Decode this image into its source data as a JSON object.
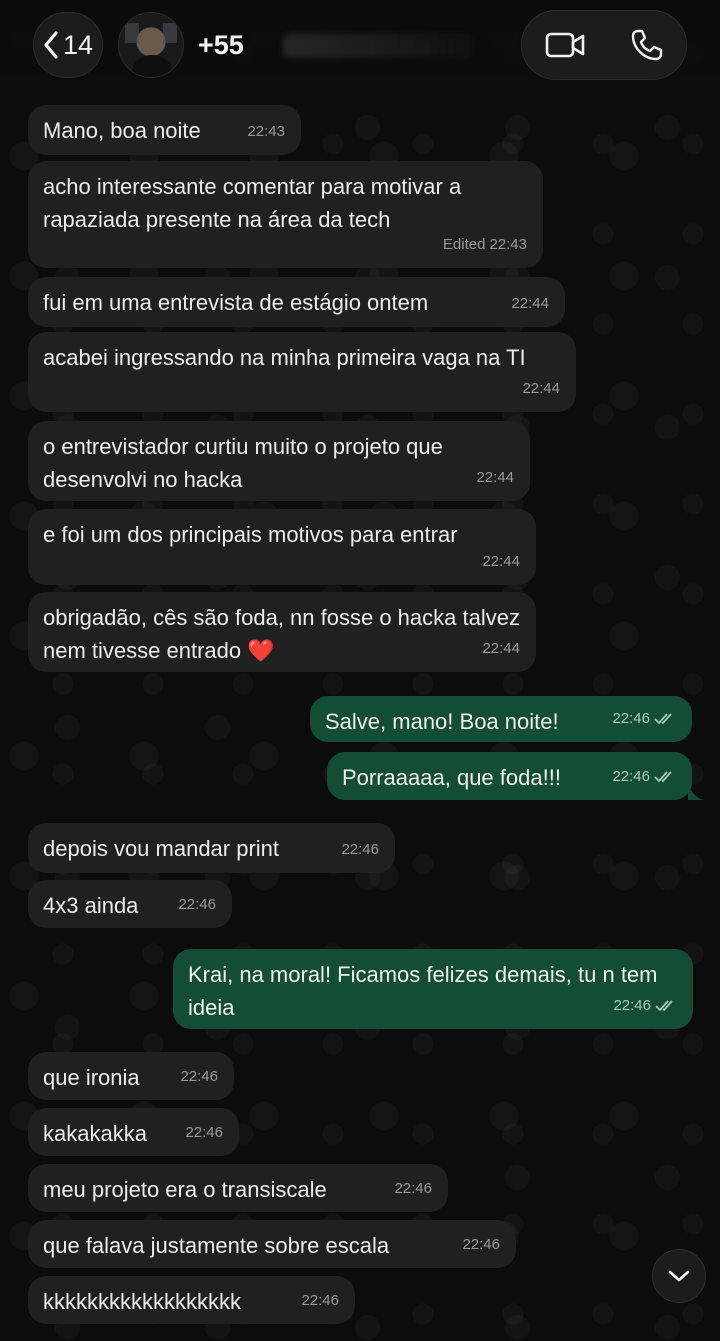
{
  "header": {
    "back_count": "14",
    "contact_name": "+55",
    "icons": {
      "back": "chevron-left-icon",
      "video": "video-camera-icon",
      "call": "phone-icon"
    }
  },
  "messages": [
    {
      "dir": "in",
      "text": "Mano, boa noite",
      "time": "22:43"
    },
    {
      "dir": "in",
      "text": "acho interessante comentar para motivar a rapaziada presente na área da tech",
      "time": "22:43",
      "edited": "Edited"
    },
    {
      "dir": "in",
      "text": "fui em uma entrevista de estágio ontem",
      "time": "22:44"
    },
    {
      "dir": "in",
      "text": "acabei ingressando na minha primeira vaga na TI",
      "time": "22:44"
    },
    {
      "dir": "in",
      "text": "o entrevistador curtiu muito o projeto que desenvolvi no hacka",
      "time": "22:44"
    },
    {
      "dir": "in",
      "text": "e foi um dos principais motivos para entrar",
      "time": "22:44"
    },
    {
      "dir": "in",
      "text": "obrigadão, cês são foda, nn fosse o hacka talvez nem tivesse entrado ❤️",
      "time": "22:44"
    },
    {
      "dir": "out",
      "text": "Salve, mano! Boa noite!",
      "time": "22:46"
    },
    {
      "dir": "out",
      "text": "Porraaaaa, que foda!!!",
      "time": "22:46"
    },
    {
      "dir": "in",
      "text": "depois vou mandar print",
      "time": "22:46"
    },
    {
      "dir": "in",
      "text": "4x3 ainda",
      "time": "22:46"
    },
    {
      "dir": "out",
      "text": "Krai, na moral! Ficamos felizes demais, tu n tem ideia",
      "time": "22:46"
    },
    {
      "dir": "in",
      "text": "que ironia",
      "time": "22:46"
    },
    {
      "dir": "in",
      "text": "kakakakka",
      "time": "22:46"
    },
    {
      "dir": "in",
      "text": "meu projeto era o transiscale",
      "time": "22:46"
    },
    {
      "dir": "in",
      "text": "que falava justamente sobre escala",
      "time": "22:46"
    },
    {
      "dir": "in",
      "text": "kkkkkkkkkkkkkkkkkk",
      "time": "22:46"
    }
  ],
  "colors": {
    "incoming_bubble": "#202020",
    "outgoing_bubble": "#134d37",
    "background": "#0c0c0c"
  }
}
